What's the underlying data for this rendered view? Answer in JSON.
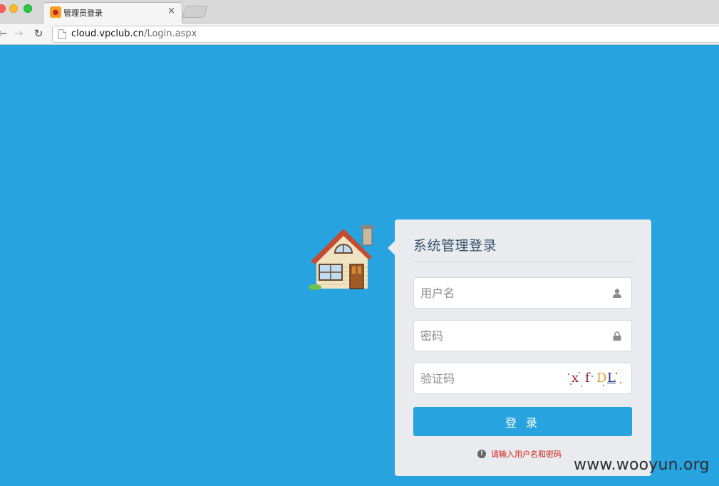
{
  "browser": {
    "tab_title": "管理员登录",
    "tab_close": "×",
    "url_host": "cloud.vpclub.cn",
    "url_path": "/Login.aspx",
    "back_glyph": "←",
    "forward_glyph": "→",
    "reload_glyph": "↻",
    "favicon": "lion-icon"
  },
  "login": {
    "title": "系统管理登录",
    "username_placeholder": "用户名",
    "password_placeholder": "密码",
    "captcha_placeholder": "验证码",
    "captcha_chars": [
      "x",
      "f",
      "D",
      "L"
    ],
    "submit_label": "登 录",
    "error_icon": "!",
    "error_message": "请输入用户名和密码"
  },
  "watermark": "www.wooyun.org",
  "colors": {
    "background": "#27a3e0",
    "panel": "#e9ebee",
    "button": "#27a3e0",
    "error": "#d8221b",
    "title": "#35506b"
  }
}
